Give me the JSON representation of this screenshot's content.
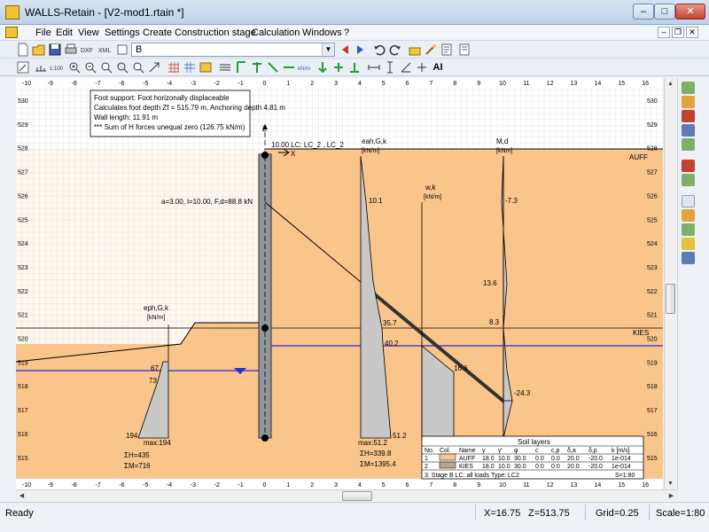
{
  "window": {
    "title": "WALLS-Retain - [V2-mod1.rtain *]",
    "min_label": "–",
    "max_label": "□",
    "close_label": "✕"
  },
  "menu": {
    "items": [
      "File",
      "Edit",
      "View",
      "Settings",
      "Create",
      "Construction stage",
      "Calculation",
      "Windows",
      "?"
    ]
  },
  "toolbar": {
    "stage_value": "B",
    "ai_label": "AI"
  },
  "axes": {
    "x_ticks": [
      "-10",
      "-9",
      "-8",
      "-7",
      "-6",
      "-5",
      "-4",
      "-3",
      "-2",
      "-1",
      "0",
      "1",
      "2",
      "3",
      "4",
      "5",
      "6",
      "7",
      "8",
      "9",
      "10",
      "11",
      "12",
      "13",
      "14",
      "15",
      "16"
    ],
    "y_ticks": [
      "530",
      "529",
      "528",
      "527",
      "526",
      "525",
      "524",
      "523",
      "522",
      "521",
      "520",
      "519",
      "518",
      "517",
      "516",
      "515"
    ]
  },
  "info_box": {
    "lines": [
      "Foot support: Foot horizonally displaceable",
      "Calculates foot depth Zf = 515.79 m, Anchoring depth 4.81 m",
      "Wall length: 11.91 m",
      "*** Sum of H forces unequal zero (126.75 kN/m)"
    ]
  },
  "labels": {
    "wall_axis_z": "Z",
    "wall_axis_x": "X",
    "lc_label": "10.00 LC: LC_2 , LC_2",
    "anchor_label": "a=3.00, l=10.00, F,d=88.8 kN",
    "layer_top": "AUFF",
    "layer_kies": "KIES"
  },
  "diagrams": {
    "eah": {
      "title": "eah,G,k",
      "unit": "[kN/m]",
      "v1": "10.1",
      "v2": "35.7",
      "v3": "40.2",
      "v4": "51.2",
      "max": "max:51.2",
      "sumH": "ΣH=339.8",
      "sumM": "ΣM=1395.4"
    },
    "eph": {
      "title": "eph,G,k",
      "unit": "[kN/m]",
      "v1": "67",
      "v2": "73",
      "v3": "194",
      "max": "max:194",
      "sumH": "ΣH=435",
      "sumM": "ΣM=716"
    },
    "wk": {
      "title": "w,k",
      "unit": "[kN/m]",
      "v1": "16.6"
    },
    "md": {
      "title": "M,d",
      "unit": "[kNm]",
      "v1": "-7.3",
      "v2": "13.6",
      "v3": "8.3",
      "v4": "-24.3"
    }
  },
  "soil_table": {
    "title": "Soil layers",
    "headers": [
      "No.",
      "Col.",
      "Name",
      "γ",
      "γ'",
      "φ",
      "c",
      "c,p",
      "δ,a",
      "δ,p",
      "k [m/s]"
    ],
    "rows": [
      [
        "1",
        "",
        "AUFF",
        "18.0",
        "10.0",
        "30.0",
        "0.0",
        "0.0",
        "20.0",
        "-20.0",
        "1e-014"
      ],
      [
        "2",
        "",
        "KIES",
        "18.0",
        "10.0",
        "30.0",
        "0.0",
        "0.0",
        "20.0",
        "-20.0",
        "1e-014"
      ]
    ],
    "row_colors": [
      "#f9c58a",
      "#b4a594"
    ],
    "footer_left": "3. Stage B LC:  all loads   Type: LC2",
    "footer_right": "S=1:80"
  },
  "status": {
    "ready": "Ready",
    "x": "X=16.75",
    "z": "Z=513.75",
    "grid": "Grid=0.25",
    "scale": "Scale=1:80"
  },
  "colors": {
    "soil": "#f9c58a",
    "wall": "#8f969c",
    "water": "#2a2ad8",
    "diagram_fill": "#c8c8c8"
  }
}
